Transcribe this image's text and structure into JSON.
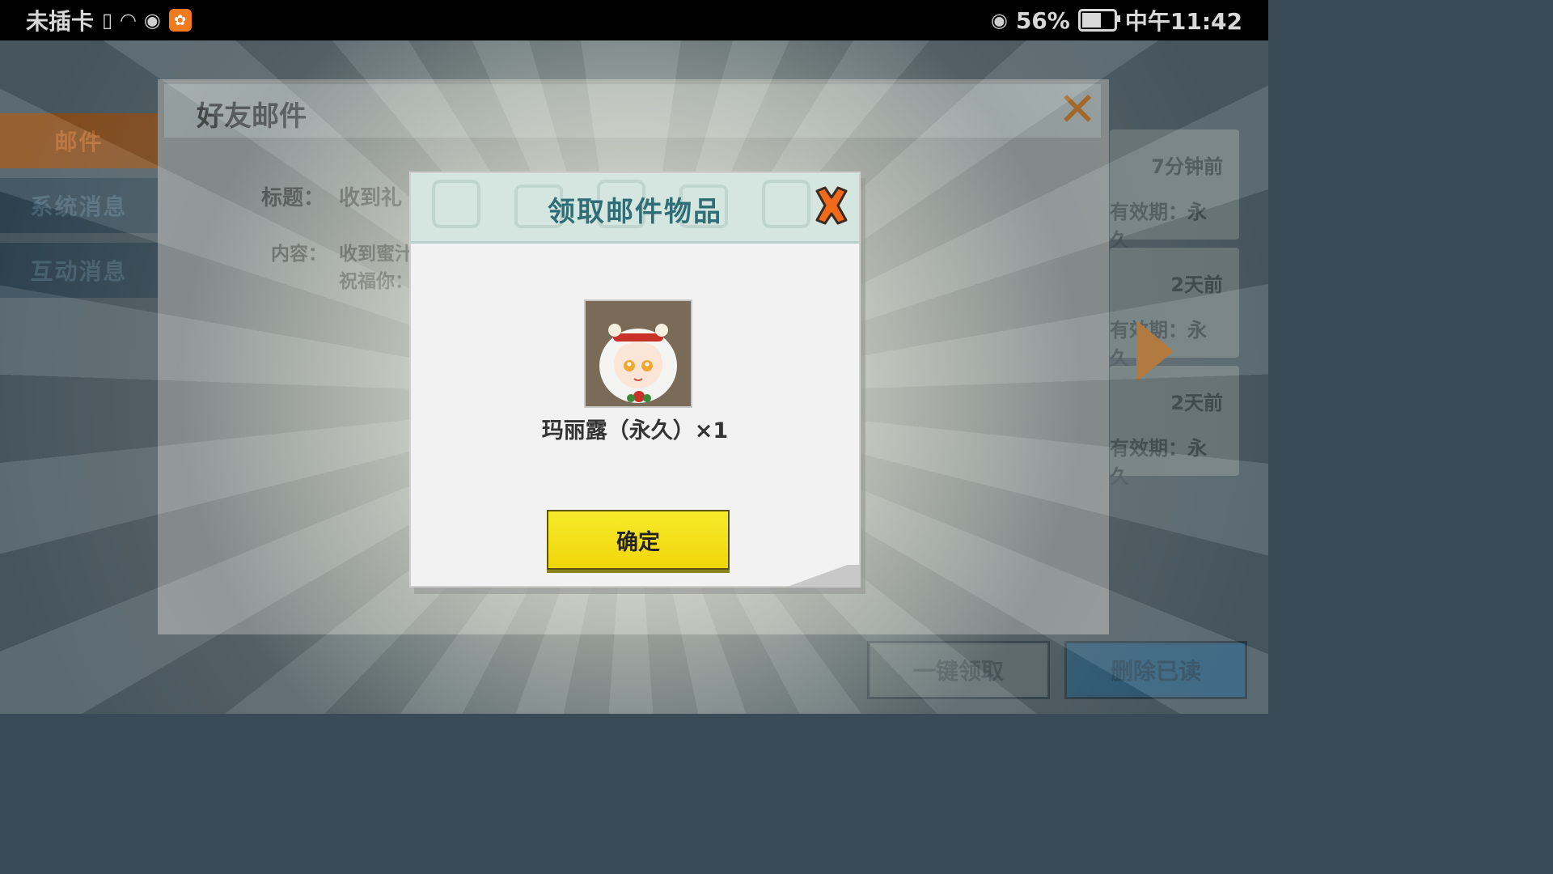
{
  "status_bar": {
    "carrier": "未插卡",
    "battery": "56%",
    "battery_level": 0.56,
    "time": "中午11:42"
  },
  "background": {
    "side_tabs": [
      "邮件",
      "系统消息",
      "互动消息"
    ],
    "mail_cards": [
      {
        "time": "7分钟前",
        "validity": "有效期：永久"
      },
      {
        "time": "2天前",
        "validity": "有效期：永久"
      },
      {
        "time": "2天前",
        "validity": "有效期：永久"
      }
    ],
    "claim_all_label": "一键领取",
    "delete_read_label": "删除已读"
  },
  "friend_mail": {
    "title": "好友邮件",
    "subject_label": "标题：",
    "subject_value": "收到礼",
    "content_label": "内容：",
    "content_line1": "收到蜜汁",
    "content_line2": "祝福你："
  },
  "reward_dialog": {
    "title": "领取邮件物品",
    "item_name": "玛丽露（永久）×1",
    "confirm_label": "确定",
    "close_icon": "close-x-icon"
  }
}
